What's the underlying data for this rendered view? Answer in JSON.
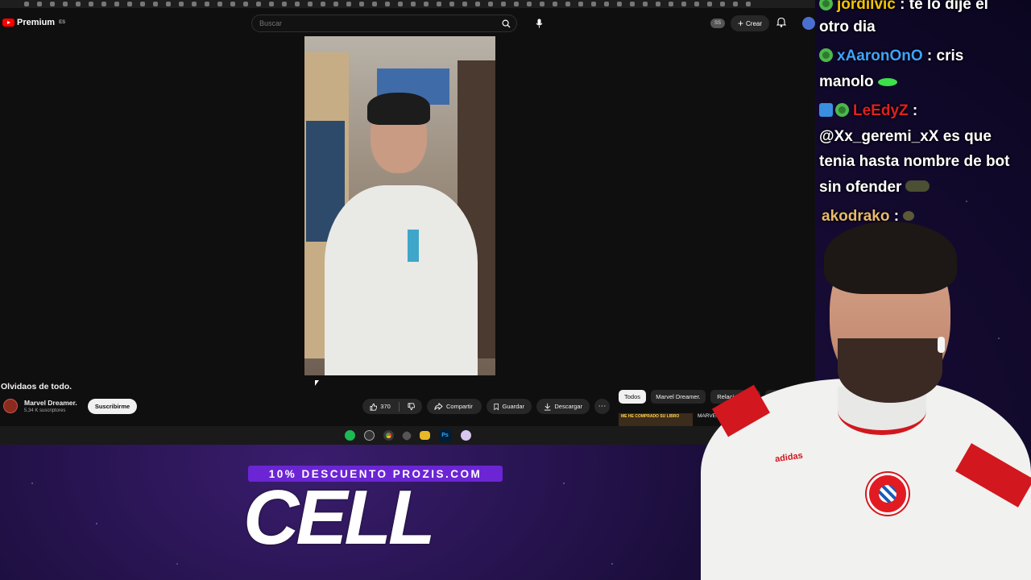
{
  "youtube": {
    "brand": "Premium",
    "region": "ES",
    "search_placeholder": "Buscar",
    "ss_badge": "SS",
    "create_label": "Crear",
    "video_title": "Olvidaos de todo.",
    "channel_name": "Marvel Dreamer.",
    "channel_subs": "5,34 K suscriptores",
    "subscribe_label": "Suscribirme",
    "likes": "370",
    "share_label": "Compartir",
    "save_label": "Guardar",
    "download_label": "Descargar",
    "chips": [
      "Todos",
      "Marvel Dreamer.",
      "Relacionados"
    ],
    "related_thumb_text": "ME HE COMPRADO SU LIBRO",
    "related_title": "MARVEL DR... ESCRITO..."
  },
  "chat": [
    {
      "user": "jordilvic",
      "user_color": "#f2c400",
      "badges": [
        "green"
      ],
      "text": ": te lo dije el",
      "cont": "otro dia"
    },
    {
      "user": "xAaronOnO",
      "user_color": "#3ea3ff",
      "badges": [
        "green"
      ],
      "text": ": cris",
      "cont": "manolo"
    },
    {
      "user": "LeEdyZ",
      "user_color": "#e02020",
      "badges": [
        "blue",
        "green"
      ],
      "text": ":",
      "cont": "@Xx_geremi_xX es que",
      "cont2": "tenia hasta nombre de bot",
      "cont3": "sin ofender"
    },
    {
      "user": "akodrako",
      "user_color": "#e8b96a",
      "badges": [],
      "text": ":"
    }
  ],
  "promo": {
    "banner": "10% DESCUENTO PROZIS.COM",
    "big": "CELL"
  },
  "webcam": {
    "shirt_brand": "adidas"
  },
  "colors": {
    "youtube_red": "#ff0000",
    "bayern_red": "#d2171e",
    "promo_purple": "#6b25d4"
  }
}
